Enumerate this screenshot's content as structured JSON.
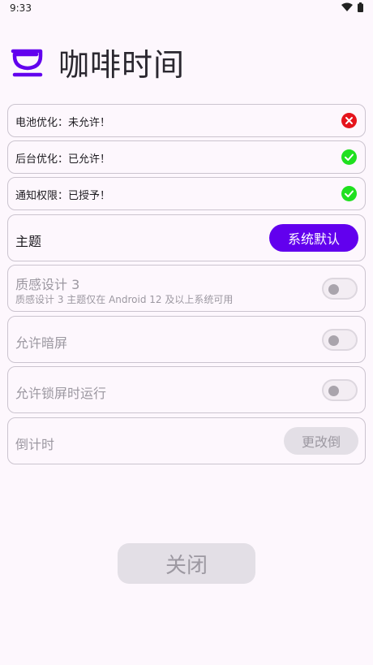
{
  "status_bar": {
    "time": "9:33"
  },
  "app": {
    "title": "咖啡时间",
    "accent": "#6200ee"
  },
  "permissions": [
    {
      "label": "电池优化：未允许！",
      "status": "denied"
    },
    {
      "label": "后台优化：已允许！",
      "status": "granted"
    },
    {
      "label": "通知权限：已授予！",
      "status": "granted"
    }
  ],
  "colors": {
    "denied": "#e5141c",
    "granted": "#1fe01f"
  },
  "theme": {
    "label": "主题",
    "button_label": "系统默认"
  },
  "material_you": {
    "label": "质感设计 3",
    "description": "质感设计 3 主题仅在 Android 12 及以上系统可用",
    "enabled": false
  },
  "allow_dim": {
    "label": "允许暗屏",
    "enabled": false
  },
  "allow_lockscreen": {
    "label": "允许锁屏时运行",
    "enabled": false
  },
  "countdown": {
    "label": "倒计时",
    "button_label": "更改倒"
  },
  "close_button": {
    "label": "关闭"
  }
}
